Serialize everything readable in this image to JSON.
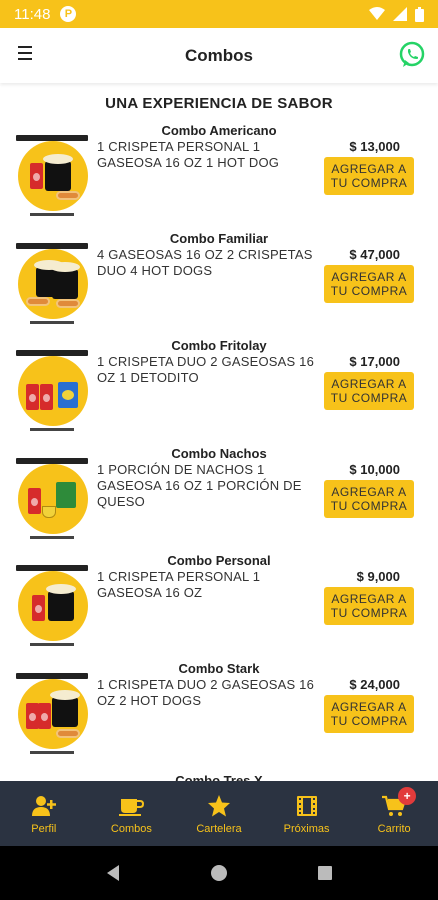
{
  "status": {
    "time": "11:48",
    "app_badge": "P"
  },
  "header": {
    "title": "Combos"
  },
  "headline": "UNA EXPERIENCIA DE SABOR",
  "combos": [
    {
      "title": "Combo Americano",
      "description": "1 CRISPETA PERSONAL 1 GASEOSA 16 OZ 1 HOT DOG",
      "price": "$ 13,000",
      "button": "AGREGAR A TU COMPRA"
    },
    {
      "title": "Combo Familiar",
      "description": "4 GASEOSAS 16 OZ 2 CRISPETAS DUO 4 HOT DOGS",
      "price": "$ 47,000",
      "button": "AGREGAR A TU COMPRA"
    },
    {
      "title": "Combo Fritolay",
      "description": "1 CRISPETA DUO 2 GASEOSAS 16 OZ 1 DETODITO",
      "price": "$ 17,000",
      "button": "AGREGAR A TU COMPRA"
    },
    {
      "title": "Combo Nachos",
      "description": "1 PORCIÓN DE NACHOS 1 GASEOSA 16 OZ 1 PORCIÓN DE QUESO",
      "price": "$ 10,000",
      "button": "AGREGAR A TU COMPRA"
    },
    {
      "title": "Combo Personal",
      "description": "1 CRISPETA PERSONAL 1 GASEOSA 16 OZ",
      "price": "$ 9,000",
      "button": "AGREGAR A TU COMPRA"
    },
    {
      "title": "Combo Stark",
      "description": "1 CRISPETA DUO 2 GASEOSAS 16 OZ 2 HOT DOGS",
      "price": "$ 24,000",
      "button": "AGREGAR A TU COMPRA"
    }
  ],
  "peek_title": "Combo Tres X",
  "nav": [
    {
      "label": "Perfil",
      "icon": "person-add-icon"
    },
    {
      "label": "Combos",
      "icon": "coffee-cup-icon"
    },
    {
      "label": "Cartelera",
      "icon": "star-icon"
    },
    {
      "label": "Próximas",
      "icon": "film-icon"
    },
    {
      "label": "Carrito",
      "icon": "cart-icon"
    }
  ],
  "cart_badge": "+",
  "colors": {
    "accent": "#f7c21a",
    "nav_bg": "#2b3341",
    "badge": "#e23b3b",
    "whatsapp": "#25d366"
  }
}
